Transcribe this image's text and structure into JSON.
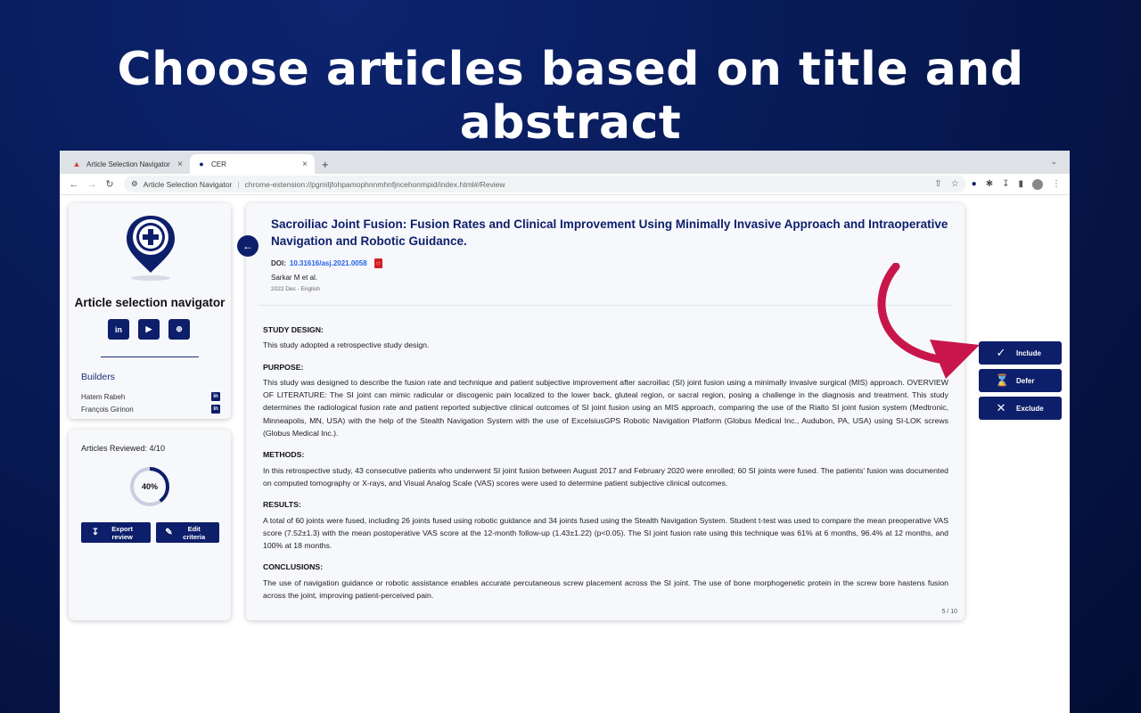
{
  "headline": "Choose articles based on title and abstract",
  "browser": {
    "tabs": [
      {
        "label": "Article Selection Navigator",
        "icon": "app-favicon"
      },
      {
        "label": "CER",
        "icon": "extension-favicon"
      }
    ],
    "address_site": "Article Selection Navigator",
    "address_url": "chrome-extension://pgmiljfohpamophnnmhnfjncehonmpid/index.html#/Review"
  },
  "sidebar": {
    "app_title": "Article selection navigator",
    "socials": [
      "in",
      "▶",
      "⊕"
    ],
    "builders_title": "Builders",
    "builders": [
      "Hatem Rabeh",
      "François Girinon"
    ],
    "reviewed_label": "Articles Reviewed: 4/10",
    "progress_label": "40%",
    "progress": 0.4,
    "export_label": "Export review",
    "edit_label": "Edit criteria"
  },
  "article": {
    "title": "Sacroiliac Joint Fusion: Fusion Rates and Clinical Improvement Using Minimally Invasive Approach and Intraoperative Navigation and Robotic Guidance.",
    "doi_prefix": "DOI:",
    "doi": "10.31616/asj.2021.0058",
    "authors": "Sarkar M et al.",
    "date": "2022 Dec - English",
    "sections": [
      {
        "title": "STUDY DESIGN:",
        "text": "This study adopted a retrospective study design."
      },
      {
        "title": "PURPOSE:",
        "text": "This study was designed to describe the fusion rate and technique and patient subjective improvement after sacroiliac (SI) joint fusion using a minimally invasive surgical (MIS) approach. OVERVIEW OF LITERATURE: The SI joint can mimic radicular or discogenic pain localized to the lower back, gluteal region, or sacral region, posing a challenge in the diagnosis and treatment. This study determines the radiological fusion rate and patient reported subjective clinical outcomes of SI joint fusion using an MIS approach, comparing the use of the Rialto SI joint fusion system (Medtronic, Minneapolis, MN, USA) with the help of the Stealth Navigation System with the use of ExcelsiusGPS Robotic Navigation Platform (Globus Medical Inc., Audubon, PA, USA) using SI-LOK screws (Globus Medical Inc.)."
      },
      {
        "title": "METHODS:",
        "text": "In this retrospective study, 43 consecutive patients who underwent SI joint fusion between August 2017 and February 2020 were enrolled; 60 SI joints were fused. The patients' fusion was documented on computed tomography or X-rays, and Visual Analog Scale (VAS) scores were used to determine patient subjective clinical outcomes."
      },
      {
        "title": "RESULTS:",
        "text": "A total of 60 joints were fused, including 26 joints fused using robotic guidance and 34 joints fused using the Stealth Navigation System. Student t-test was used to compare the mean preoperative VAS score (7.52±1.3) with the mean postoperative VAS score at the 12-month follow-up (1.43±1.22) (p<0.05). The SI joint fusion rate using this technique was 61% at 6 months, 96.4% at 12 months, and 100% at 18 months."
      },
      {
        "title": "CONCLUSIONS:",
        "text": "The use of navigation guidance or robotic assistance enables accurate percutaneous screw placement across the SI joint. The use of bone morphogenetic protein in the screw bore hastens fusion across the joint, improving patient-perceived pain."
      }
    ],
    "pager": "5 / 10"
  },
  "decisions": {
    "include": "Include",
    "defer": "Defer",
    "exclude": "Exclude"
  },
  "colors": {
    "primary": "#0d1f6b",
    "accent_arrow": "#c8164b",
    "doi_link": "#2563eb"
  }
}
